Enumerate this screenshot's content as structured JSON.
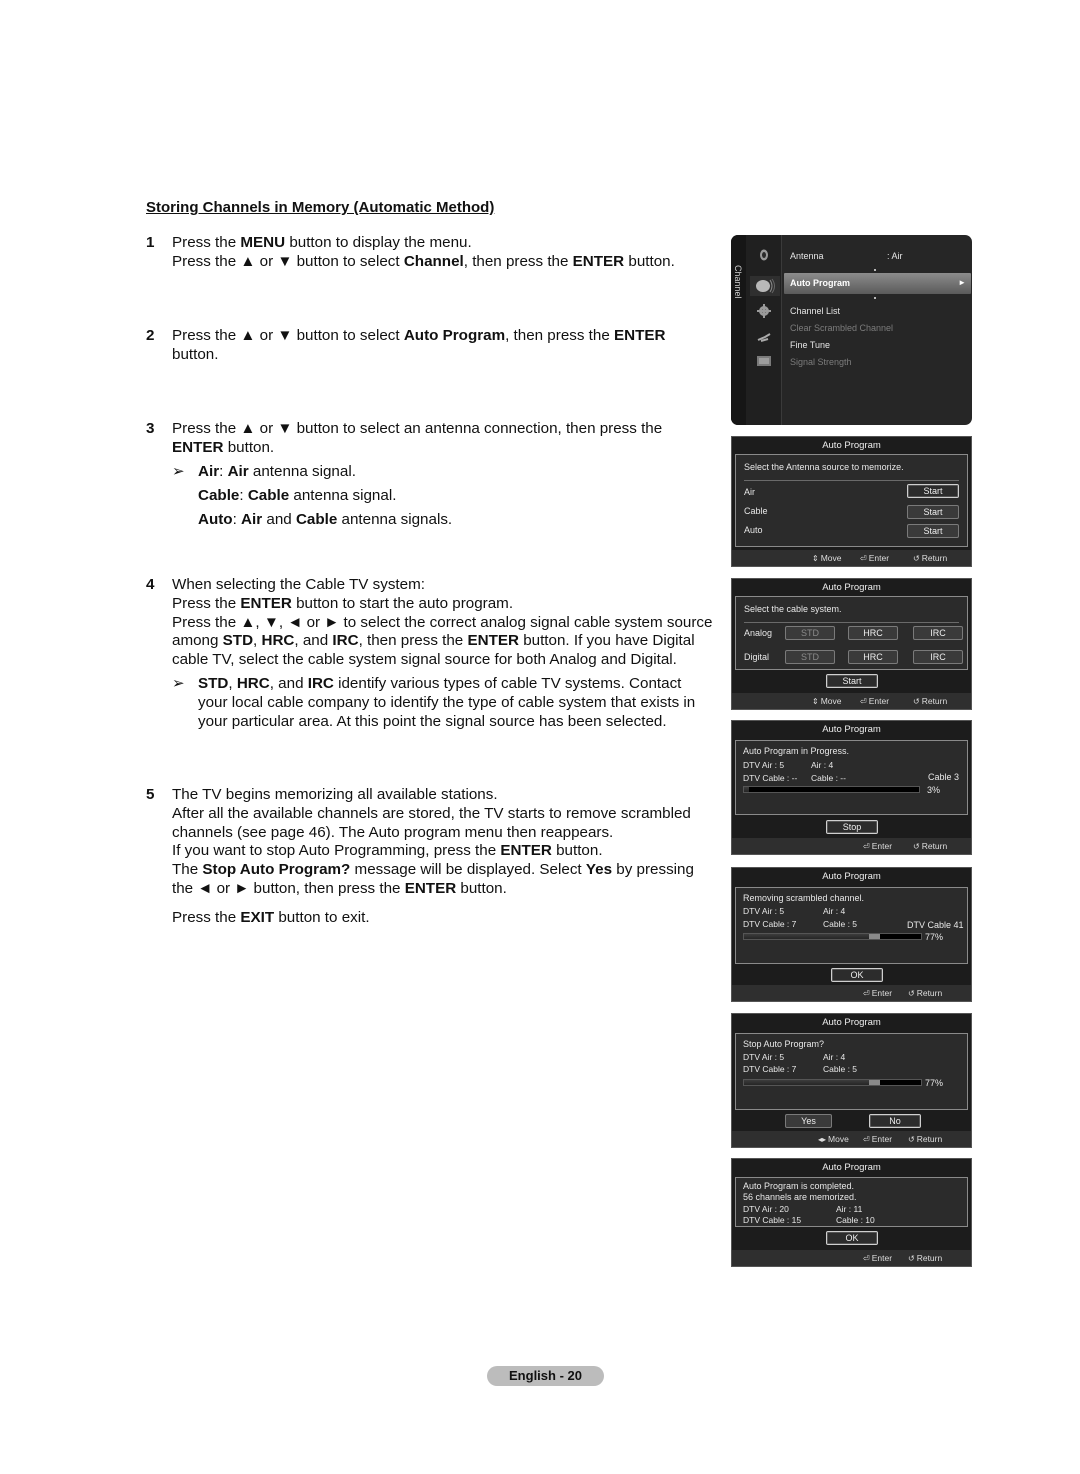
{
  "section_title": "Storing Channels in Memory (Automatic Method)",
  "steps": [
    {
      "num": "1",
      "lines": [
        [
          {
            "t": "Press the "
          },
          {
            "t": "MENU",
            "b": true
          },
          {
            "t": " button to display the menu."
          }
        ],
        [
          {
            "t": "Press the ▲ or ▼ button to select "
          },
          {
            "t": "Channel",
            "b": true
          },
          {
            "t": ", then press the "
          },
          {
            "t": "ENTER",
            "b": true
          },
          {
            "t": " button."
          }
        ]
      ]
    },
    {
      "num": "2",
      "lines": [
        [
          {
            "t": "Press the ▲ or ▼ button to select "
          },
          {
            "t": "Auto Program",
            "b": true
          },
          {
            "t": ", then press the "
          },
          {
            "t": "ENTER",
            "b": true
          }
        ],
        [
          {
            "t": "button."
          }
        ]
      ]
    },
    {
      "num": "3",
      "lines": [
        [
          {
            "t": "Press the ▲ or ▼ button to select an antenna connection, then press the"
          }
        ],
        [
          {
            "t": "ENTER",
            "b": true
          },
          {
            "t": " button."
          }
        ]
      ],
      "note": {
        "arrow": "➢",
        "lines": [
          [
            {
              "t": "Air",
              "b": true
            },
            {
              "t": ": "
            },
            {
              "t": "Air",
              "b": true
            },
            {
              "t": " antenna signal."
            }
          ],
          [
            {
              "t": "Cable",
              "b": true
            },
            {
              "t": ": "
            },
            {
              "t": "Cable",
              "b": true
            },
            {
              "t": " antenna signal."
            }
          ],
          [
            {
              "t": "Auto",
              "b": true
            },
            {
              "t": ": "
            },
            {
              "t": "Air",
              "b": true
            },
            {
              "t": " and "
            },
            {
              "t": "Cable",
              "b": true
            },
            {
              "t": " antenna signals."
            }
          ]
        ],
        "spaced": true
      }
    },
    {
      "num": "4",
      "lines": [
        [
          {
            "t": "When selecting the Cable TV system:"
          }
        ],
        [
          {
            "t": "Press the "
          },
          {
            "t": "ENTER",
            "b": true
          },
          {
            "t": " button to start the auto program."
          }
        ],
        [
          {
            "t": "Press the ▲, ▼, ◄ or ► to select the correct analog signal cable system source"
          }
        ],
        [
          {
            "t": "among "
          },
          {
            "t": "STD",
            "b": true
          },
          {
            "t": ", "
          },
          {
            "t": "HRC",
            "b": true
          },
          {
            "t": ", and "
          },
          {
            "t": "IRC",
            "b": true
          },
          {
            "t": ", then press the "
          },
          {
            "t": "ENTER",
            "b": true
          },
          {
            "t": " button. If you have Digital"
          }
        ],
        [
          {
            "t": "cable TV, select the cable system signal source for both Analog and Digital."
          }
        ]
      ],
      "note": {
        "arrow": "➢",
        "lines": [
          [
            {
              "t": "STD",
              "b": true
            },
            {
              "t": ", "
            },
            {
              "t": "HRC",
              "b": true
            },
            {
              "t": ", and "
            },
            {
              "t": "IRC",
              "b": true
            },
            {
              "t": " identify various types of cable TV systems. Contact"
            }
          ],
          [
            {
              "t": "your local cable company to identify the type of cable system that exists in"
            }
          ],
          [
            {
              "t": "your particular area. At this point the signal source has been selected."
            }
          ]
        ],
        "spaced": false
      }
    },
    {
      "num": "5",
      "lines": [
        [
          {
            "t": "The TV begins memorizing all available stations."
          }
        ],
        [
          {
            "t": "After all the available channels are stored, the TV starts to remove scrambled"
          }
        ],
        [
          {
            "t": "channels (see page 46). The Auto program menu then reappears."
          }
        ],
        [
          {
            "t": "If you want to stop Auto Programming, press the "
          },
          {
            "t": "ENTER",
            "b": true
          },
          {
            "t": " button."
          }
        ],
        [
          {
            "t": "The "
          },
          {
            "t": "Stop Auto Program?",
            "b": true
          },
          {
            "t": " message will be displayed. Select "
          },
          {
            "t": "Yes",
            "b": true
          },
          {
            "t": " by pressing"
          }
        ],
        [
          {
            "t": "the ◄ or ► button, then press the "
          },
          {
            "t": "ENTER",
            "b": true
          },
          {
            "t": " button."
          }
        ]
      ],
      "tail": [
        {
          "t": "Press the "
        },
        {
          "t": "EXIT",
          "b": true
        },
        {
          "t": " button to exit."
        }
      ]
    }
  ],
  "channel_menu": {
    "tab_label": "Channel",
    "icons": [
      "antenna-icon",
      "satellite-dish-icon",
      "gear-icon",
      "plug-icon",
      "signal-meter-icon"
    ],
    "items": [
      {
        "label": "Antenna",
        "value": ": Air",
        "dim": false
      },
      {
        "label": "Auto Program",
        "selected": true,
        "arrow": "►"
      },
      {
        "label": "Channel List",
        "dim": false
      },
      {
        "label": "Clear Scrambled Channel",
        "dim": true
      },
      {
        "label": "Fine Tune",
        "dim": false
      },
      {
        "label": "Signal Strength",
        "dim": true
      }
    ]
  },
  "dialogs": {
    "antenna": {
      "title": "Auto Program",
      "prompt": "Select the Antenna source to memorize.",
      "rows": [
        {
          "label": "Air",
          "button": "Start",
          "focused": true
        },
        {
          "label": "Cable",
          "button": "Start",
          "focused": false
        },
        {
          "label": "Auto",
          "button": "Start",
          "focused": false
        }
      ],
      "hints": {
        "move": "Move",
        "enter": "Enter",
        "return": "Return"
      }
    },
    "cable_system": {
      "title": "Auto Program",
      "prompt": "Select the cable system.",
      "rows": [
        {
          "label": "Analog",
          "options": [
            "STD",
            "HRC",
            "IRC"
          ]
        },
        {
          "label": "Digital",
          "options": [
            "STD",
            "HRC",
            "IRC"
          ]
        }
      ],
      "start": "Start",
      "hints": {
        "move": "Move",
        "enter": "Enter",
        "return": "Return"
      }
    },
    "in_progress": {
      "title": "Auto Program",
      "status": "Auto Program in Progress.",
      "dtv_air": "DTV Air : 5",
      "air": "Air : 4",
      "dtv_cable": "DTV Cable : --",
      "cable": "Cable : --",
      "current": "Cable 3",
      "percent_label": "3%",
      "progress": 0.03,
      "button": "Stop",
      "hints": {
        "enter": "Enter",
        "return": "Return"
      }
    },
    "removing": {
      "title": "Auto Program",
      "status": "Removing scrambled channel.",
      "dtv_air": "DTV Air : 5",
      "air": "Air : 4",
      "dtv_cable": "DTV Cable : 7",
      "cable": "Cable : 5",
      "current": "DTV Cable 41",
      "percent_label": "77%",
      "progress": 0.77,
      "button": "OK",
      "hints": {
        "enter": "Enter",
        "return": "Return"
      }
    },
    "stop_confirm": {
      "title": "Auto Program",
      "status": "Stop Auto Program?",
      "dtv_air": "DTV Air : 5",
      "air": "Air : 4",
      "dtv_cable": "DTV Cable : 7",
      "cable": "Cable : 5",
      "percent_label": "77%",
      "progress": 0.77,
      "yes": "Yes",
      "no": "No",
      "hints": {
        "move": "Move",
        "enter": "Enter",
        "return": "Return"
      }
    },
    "completed": {
      "title": "Auto Program",
      "status": "Auto Program is completed.",
      "summary": "56 channels are memorized.",
      "dtv_air": "DTV Air : 20",
      "air": "Air : 11",
      "dtv_cable": "DTV Cable : 15",
      "cable": "Cable : 10",
      "button": "OK",
      "hints": {
        "enter": "Enter",
        "return": "Return"
      }
    }
  },
  "glyphs": {
    "updown": "⇕",
    "leftright": "◂▸",
    "enter": "⏎",
    "return": "↺"
  },
  "footer": {
    "page_label": "English - 20"
  }
}
